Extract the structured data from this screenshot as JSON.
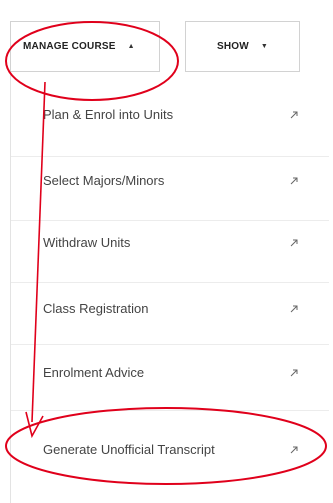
{
  "tabs": {
    "manage_course": {
      "label": "MANAGE COURSE",
      "caret": "▲"
    },
    "show": {
      "label": "SHOW",
      "caret": "▼"
    }
  },
  "menu": {
    "items": [
      {
        "label": "Plan & Enrol into Units",
        "icon": "external-link-icon"
      },
      {
        "label": "Select Majors/Minors",
        "icon": "external-link-icon"
      },
      {
        "label": "Withdraw Units",
        "icon": "external-link-icon"
      },
      {
        "label": "Class Registration",
        "icon": "external-link-icon"
      },
      {
        "label": "Enrolment Advice",
        "icon": "external-link-icon"
      },
      {
        "label": "Generate Unofficial Transcript",
        "icon": "external-link-icon"
      }
    ]
  },
  "annotation": {
    "color": "#e0001b"
  }
}
